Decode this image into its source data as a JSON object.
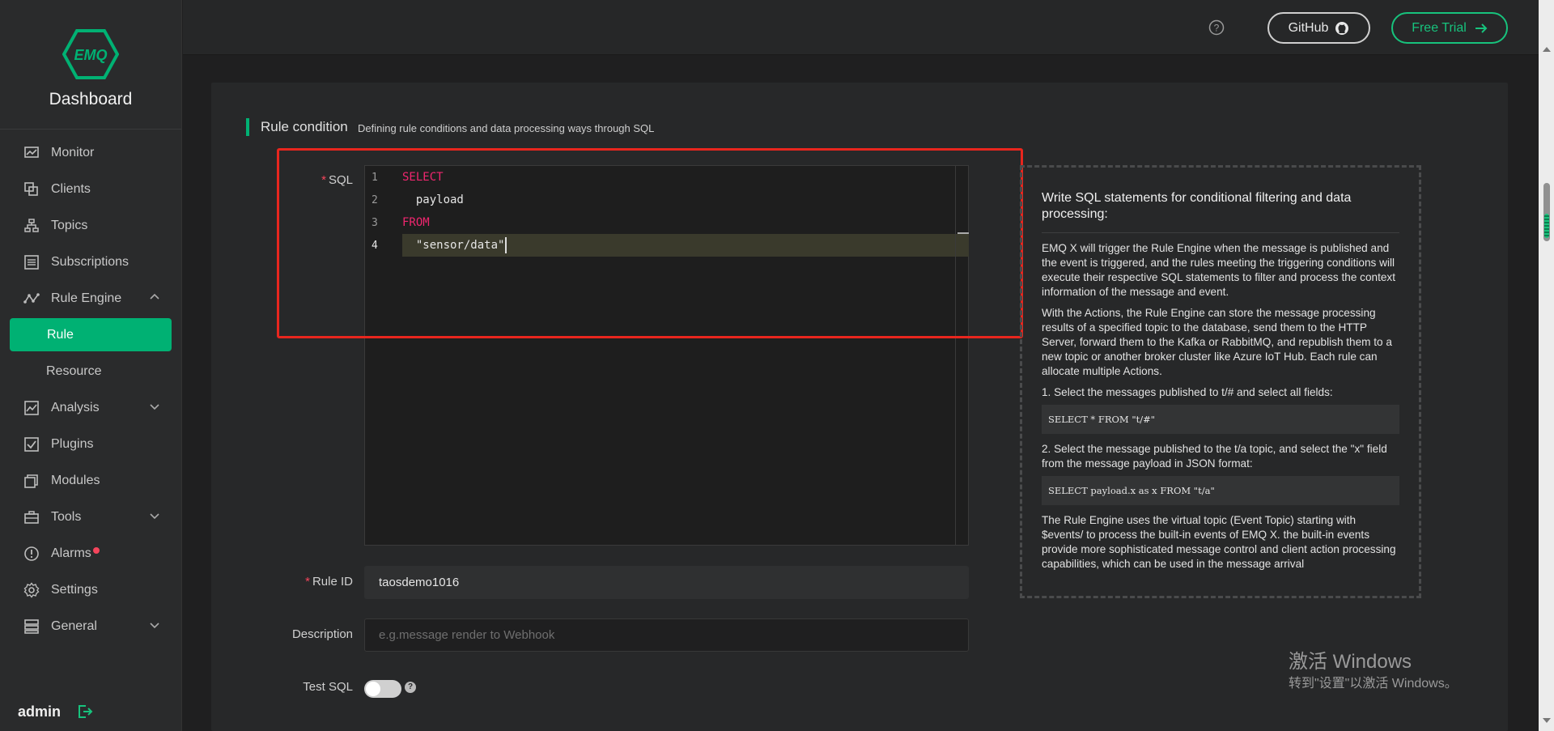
{
  "brand": {
    "logo_text": "EMQ",
    "title": "Dashboard"
  },
  "nav": {
    "monitor": "Monitor",
    "clients": "Clients",
    "topics": "Topics",
    "subscriptions": "Subscriptions",
    "rule_engine": "Rule Engine",
    "rule": "Rule",
    "resource": "Resource",
    "analysis": "Analysis",
    "plugins": "Plugins",
    "modules": "Modules",
    "tools": "Tools",
    "alarms": "Alarms",
    "settings": "Settings",
    "general": "General"
  },
  "user": {
    "name": "admin"
  },
  "header": {
    "github_label": "GitHub",
    "trial_label": "Free Trial"
  },
  "section": {
    "title": "Rule condition",
    "description": "Defining rule conditions and data processing ways through SQL"
  },
  "form": {
    "sql_label": "SQL",
    "sql_lines": [
      {
        "num": "1",
        "text": "SELECT"
      },
      {
        "num": "2",
        "text": "  payload"
      },
      {
        "num": "3",
        "text": "FROM"
      },
      {
        "num": "4",
        "text": "  \"sensor/data\""
      }
    ],
    "rule_id_label": "Rule ID",
    "rule_id_value": "taosdemo1016",
    "description_label": "Description",
    "description_placeholder": "e.g.message render to Webhook",
    "test_sql_label": "Test SQL"
  },
  "help": {
    "heading": "Write SQL statements for conditional filtering and data processing:",
    "p1": "EMQ X will trigger the Rule Engine when the message is published and the event is triggered, and the rules meeting the triggering conditions will execute their respective SQL statements to filter and process the context information of the message and event.",
    "p2": "With the Actions, the Rule Engine can store the message processing results of a specified topic to the database, send them to the HTTP Server, forward them to the Kafka or RabbitMQ, and republish them to a new topic or another broker cluster like Azure IoT Hub. Each rule can allocate multiple Actions.",
    "ex1_title": "1. Select the messages published to t/# and select all fields:",
    "ex1_code": "SELECT * FROM \"t/#\"",
    "ex2_title": "2. Select the message published to the t/a topic, and select the \"x\" field from the message payload in JSON format:",
    "ex2_code": "SELECT payload.x as x FROM \"t/a\"",
    "p3": "The Rule Engine uses the virtual topic (Event Topic) starting with $events/ to process the built-in events of EMQ X. the built-in events provide more sophisticated message control and client action processing capabilities, which can be used in the message arrival"
  },
  "watermark": {
    "line1": "激活 Windows",
    "line2": "转到\"设置\"以激活 Windows。"
  },
  "colors": {
    "accent": "#00b173",
    "highlight_box": "#e8261e",
    "keyword": "#f0266f"
  }
}
